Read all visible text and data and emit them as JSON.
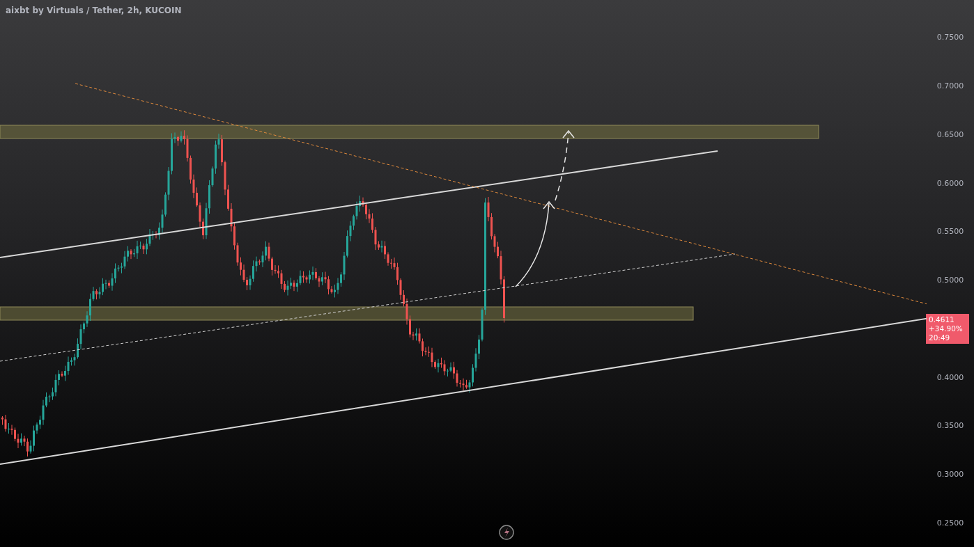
{
  "chart": {
    "title": "aixbt by Virtuals / Tether, 2h, KUCOIN"
  },
  "price_axis": {
    "labels_above": [
      "0.7500",
      "0.7000",
      "0.6500",
      "0.6000",
      "0.5500",
      "0.5000"
    ],
    "current_price": {
      "price": "0.4611",
      "change": "+34.90%",
      "countdown": "20:49"
    },
    "labels_below": [
      "0.4000",
      "0.3500",
      "0.3000",
      "0.2500"
    ]
  }
}
